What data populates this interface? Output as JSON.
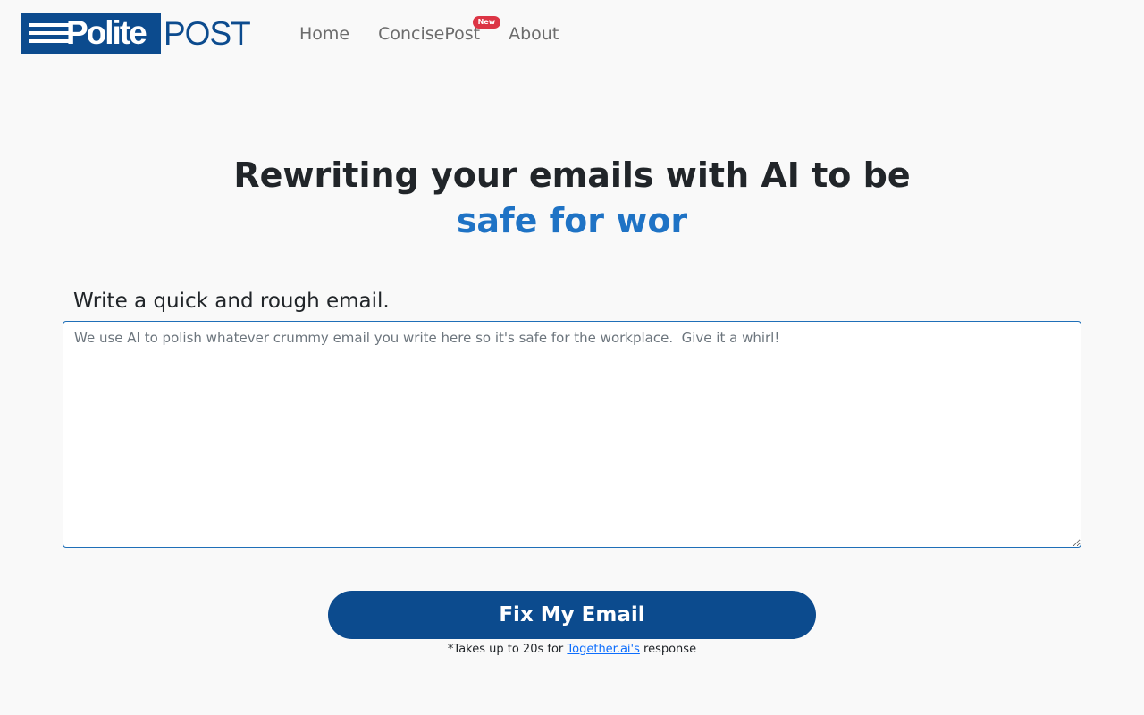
{
  "brand": {
    "logo_left": "Polite",
    "logo_right": "POST",
    "primary_color": "#0c4b8e",
    "accent_color": "#1f73c5",
    "badge_color": "#dc3545"
  },
  "nav": {
    "items": [
      {
        "label": "Home"
      },
      {
        "label": "ConcisePost",
        "badge": "New"
      },
      {
        "label": "About"
      }
    ]
  },
  "hero": {
    "title": "Rewriting your emails with AI to be",
    "accent": "safe for wor"
  },
  "form": {
    "label": "Write a quick and rough email.",
    "placeholder": "We use AI to polish whatever crummy email you write here so it's safe for the workplace.  Give it a whirl!",
    "value": "",
    "submit_label": "Fix My Email"
  },
  "note": {
    "prefix": "*Takes up to 20s for ",
    "link_text": "Together.ai's",
    "suffix": " response"
  }
}
